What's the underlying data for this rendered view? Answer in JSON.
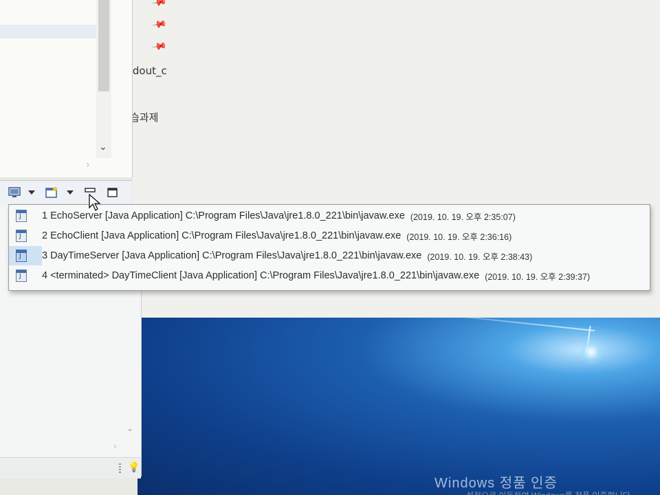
{
  "editor": {
    "line1": "tdout_c",
    "line2": "습과제"
  },
  "launch_history": {
    "items": [
      {
        "label": "1 EchoServer [Java Application] C:\\Program Files\\Java\\jre1.8.0_221\\bin\\javaw.exe",
        "timestamp": "(2019. 10. 19. 오후 2:35:07)"
      },
      {
        "label": "2 EchoClient [Java Application] C:\\Program Files\\Java\\jre1.8.0_221\\bin\\javaw.exe",
        "timestamp": "(2019. 10. 19. 오후 2:36:16)"
      },
      {
        "label": "3 DayTimeServer [Java Application] C:\\Program Files\\Java\\jre1.8.0_221\\bin\\javaw.exe",
        "timestamp": "(2019. 10. 19. 오후 2:38:43)"
      },
      {
        "label": "4 <terminated> DayTimeClient [Java Application] C:\\Program Files\\Java\\jre1.8.0_221\\bin\\javaw.exe",
        "timestamp": "(2019. 10. 19. 오후 2:39:37)"
      }
    ]
  },
  "desktop": {
    "activation_title": "Windows 정품 인증",
    "activation_sub": "설정으로 이동하여 Windows를 정품 인증합니다."
  },
  "icons": [
    "display-console-icon",
    "open-console-icon",
    "minimize-icon",
    "maximize-icon",
    "pin-icon",
    "lightbulb-icon",
    "java-app-icon"
  ],
  "colors": {
    "menu_highlight": "#cfe2f5",
    "desktop_blue": "#1d5fb0"
  }
}
